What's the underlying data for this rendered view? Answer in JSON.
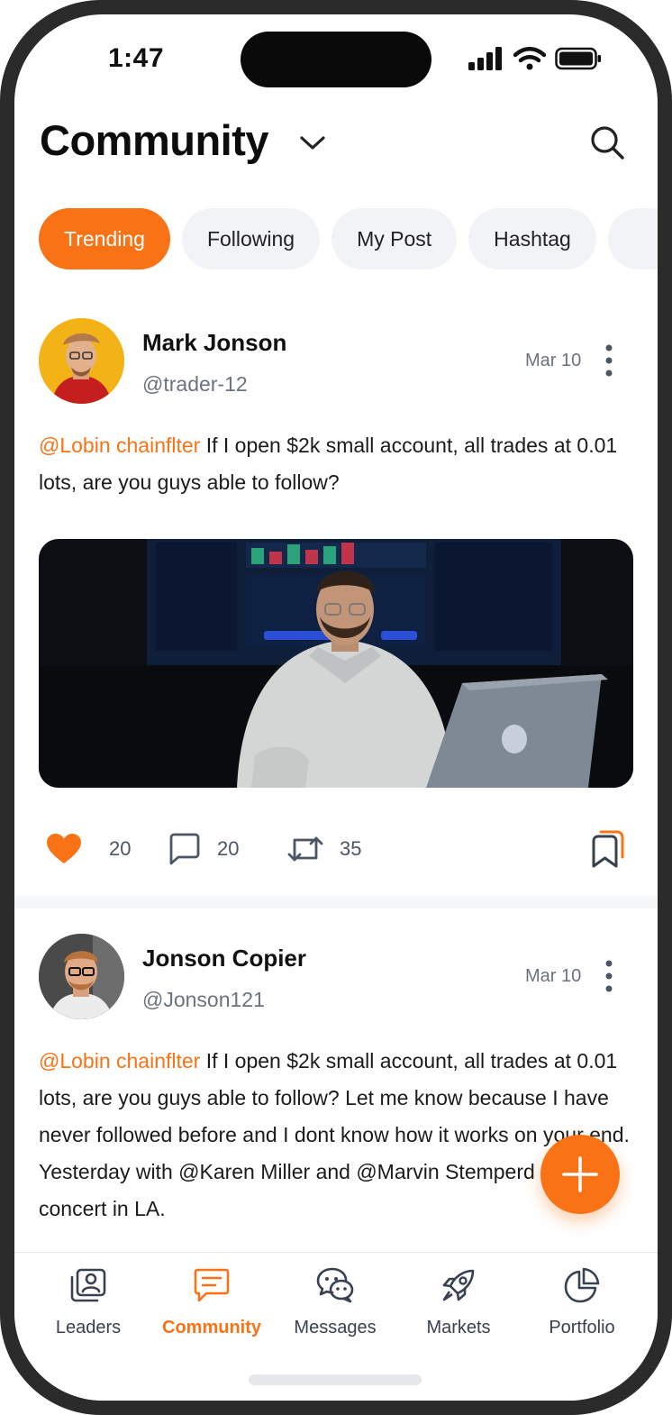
{
  "status_bar": {
    "time": "1:47"
  },
  "header": {
    "title": "Community"
  },
  "tabs": [
    {
      "label": "Trending",
      "active": true
    },
    {
      "label": "Following",
      "active": false
    },
    {
      "label": "My Post",
      "active": false
    },
    {
      "label": "Hashtag",
      "active": false
    }
  ],
  "posts": [
    {
      "author": "Mark Jonson",
      "handle": "@trader-12",
      "date": "Mar 10",
      "mention": "@Lobin chainflter",
      "text": " If I open $2k small account, all trades at 0.01 lots, are you guys able to follow?",
      "likes": "20",
      "comments": "20",
      "reposts": "35",
      "liked": true
    },
    {
      "author": "Jonson Copier",
      "handle": "@Jonson121",
      "date": "Mar 10",
      "mention": "@Lobin chainflter",
      "text": " If I open $2k small account, all trades at 0.01 lots, are you guys able to follow? Let me know because I have never followed before and I dont know how it works on your end. Yesterday with @Karen Miller and @Marvin Stemperd at the concert in LA."
    }
  ],
  "bottom_nav": [
    {
      "label": "Leaders",
      "icon": "leaders-icon",
      "active": false
    },
    {
      "label": "Community",
      "icon": "community-icon",
      "active": true
    },
    {
      "label": "Messages",
      "icon": "messages-icon",
      "active": false
    },
    {
      "label": "Markets",
      "icon": "rocket-icon",
      "active": false
    },
    {
      "label": "Portfolio",
      "icon": "pie-chart-icon",
      "active": false
    }
  ],
  "colors": {
    "accent": "#f97316",
    "tab_bg": "#f1f3f7",
    "text": "#111111",
    "muted": "#6b7280"
  }
}
